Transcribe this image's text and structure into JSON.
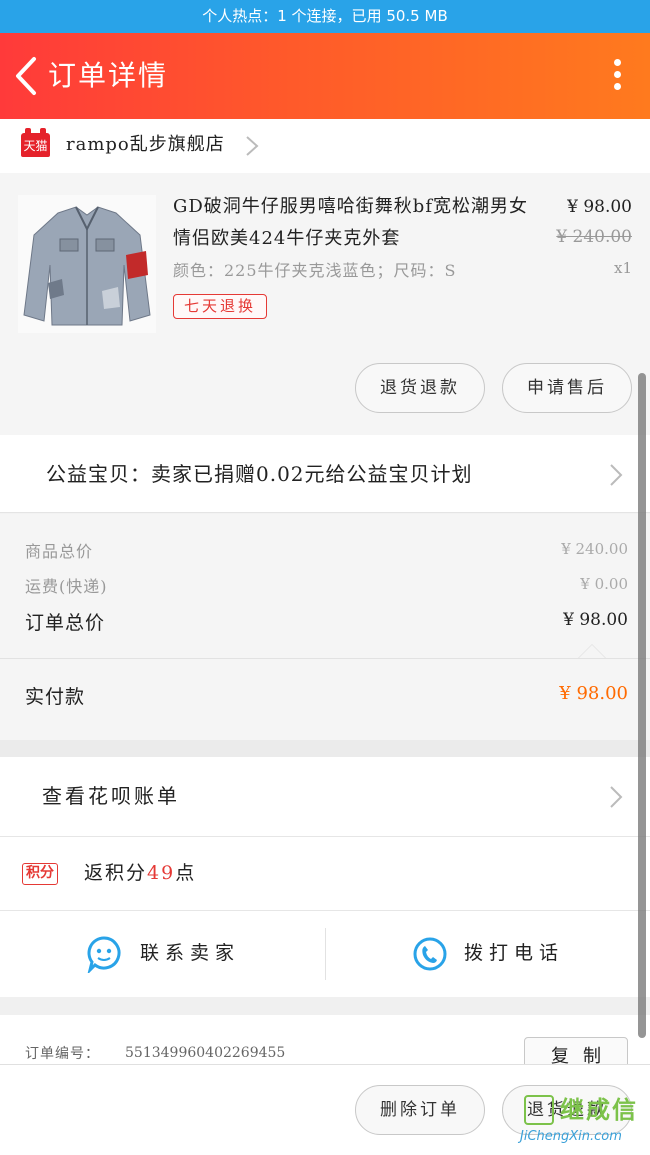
{
  "status_bar": {
    "text": "个人热点：1 个连接，已用 50.5 MB"
  },
  "header": {
    "title": "订单详情",
    "back_icon": "chevron-left-icon",
    "more_icon": "more-vertical-icon"
  },
  "store": {
    "badge": "天猫",
    "name": "rampo乱步旗舰店"
  },
  "product": {
    "title": "GD破洞牛仔服男嘻哈街舞秋bf宽松潮男女情侣欧美424牛仔夹克外套",
    "price": "¥ 98.00",
    "original_price": "¥ 240.00",
    "sku": "颜色：225牛仔夹克浅蓝色；尺码：S",
    "quantity": "x1",
    "tag": "七天退换",
    "buttons": {
      "return_exchange": "退货退款",
      "after_sale": "申请售后"
    }
  },
  "charity": {
    "text": "公益宝贝：卖家已捐赠0.02元给公益宝贝计划"
  },
  "summary": {
    "goods_total_label": "商品总价",
    "goods_total_value": "¥ 240.00",
    "shipping_label": "运费(快递)",
    "shipping_value": "¥ 0.00",
    "order_total_label": "订单总价",
    "order_total_value": "¥ 98.00",
    "paid_label": "实付款",
    "paid_value": "¥ 98.00"
  },
  "huabei": {
    "text": "查看花呗账单"
  },
  "points": {
    "badge": "积分",
    "prefix": "返积分",
    "value": "49",
    "suffix": "点"
  },
  "contact": {
    "seller_label": "联系卖家",
    "phone_label": "拨打电话"
  },
  "order": {
    "number_label": "订单编号：",
    "number": "551349960402269455",
    "copy_label": "复制"
  },
  "bottom_bar": {
    "delete_label": "删除订单",
    "return_label": "退货退款"
  },
  "watermark": {
    "main": "继成信",
    "sub": "JiChengXin.com"
  },
  "colors": {
    "header_start": "#ff3a3a",
    "header_end": "#ff7a1e",
    "status_bar": "#29a3e8",
    "accent_red": "#e53935",
    "pay_orange": "#ff6a00",
    "contact_blue": "#29a3e8"
  }
}
